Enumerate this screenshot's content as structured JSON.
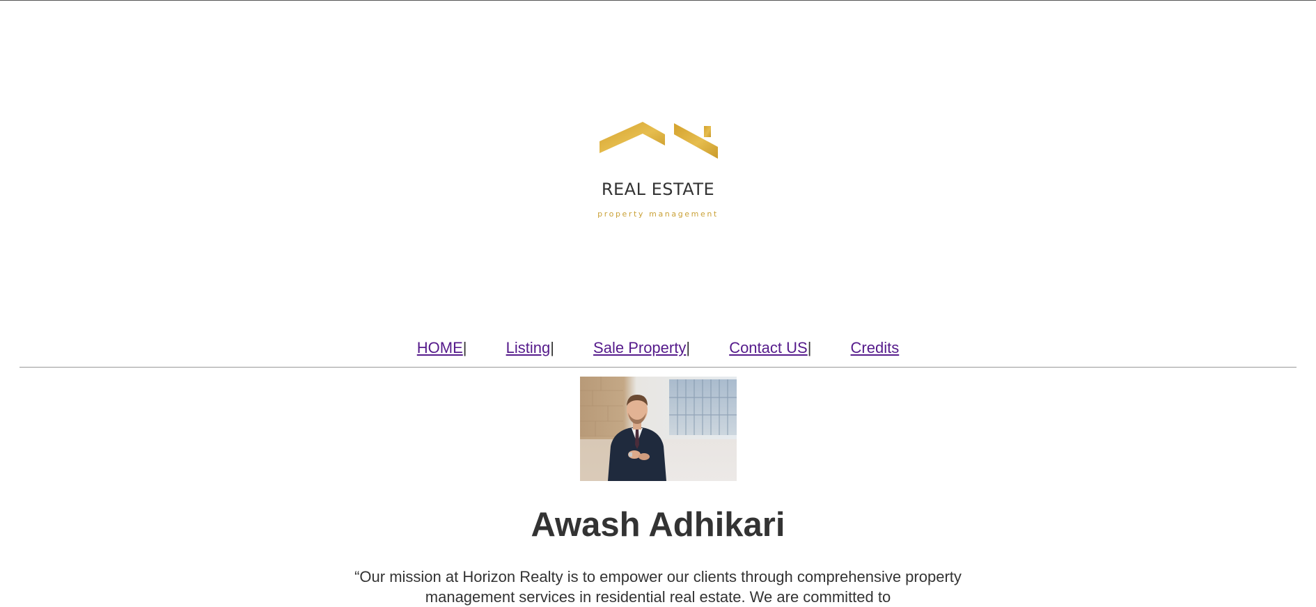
{
  "logo": {
    "title": "REAL ESTATE",
    "subtitle": "property management",
    "icon": "house-roof-icon",
    "color": "#d9aa37"
  },
  "nav": {
    "items": [
      {
        "label": "HOME",
        "separator": "|"
      },
      {
        "label": "Listing",
        "separator": "|"
      },
      {
        "label": "Sale Property",
        "separator": "|"
      },
      {
        "label": "Contact US",
        "separator": "|"
      },
      {
        "label": "Credits",
        "separator": ""
      }
    ],
    "link_color": "#551a8b"
  },
  "agent": {
    "photo": "agent-portrait-photo",
    "name": "Awash Adhikari"
  },
  "mission": {
    "text": "“Our mission at Horizon Realty is to empower our clients through comprehensive property management services in residential real estate. We are committed to"
  }
}
